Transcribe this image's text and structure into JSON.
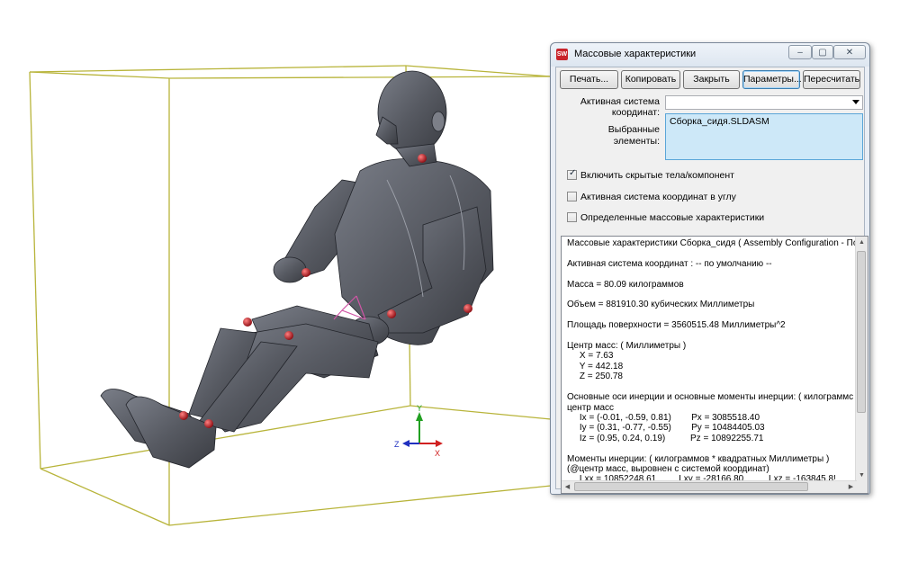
{
  "window": {
    "title": "Массовые характеристики",
    "app_icon": "SW",
    "controls": {
      "minimize": "–",
      "maximize": "▢",
      "close": "✕"
    }
  },
  "buttons": {
    "print": "Печать...",
    "copy": "Копировать",
    "close": "Закрыть",
    "options": "Параметры...",
    "recalculate": "Пересчитать"
  },
  "form": {
    "coord_label_line1": "Активная система",
    "coord_label_line2": "координат:",
    "coord_value": "",
    "selected_label": "Выбранные элементы:",
    "selected_value": "Сборка_сидя.SLDASM"
  },
  "checkboxes": [
    {
      "label": "Включить скрытые тела/компонент",
      "checked": true
    },
    {
      "label": "Активная система координат в углу",
      "checked": false
    },
    {
      "label": "Определенные массовые характеристики",
      "checked": false
    }
  ],
  "results": {
    "text": "Массовые характеристики Сборка_сидя ( Assembly Configuration - По\n\nАктивная система координат : -- по умолчанию --\n\nМасса = 80.09 килограммов\n\nОбъем = 881910.30 кубических Миллиметры\n\nПлощадь поверхности = 3560515.48 Миллиметры^2\n\nЦентр масс: ( Миллиметры )\n     X = 7.63\n     Y = 442.18\n     Z = 250.78\n\nОсновные оси инерции и основные моменты инерции: ( килограммс\nцентр масс\n     Ix = (-0.01, -0.59, 0.81)        Px = 3085518.40\n     Iy = (0.31, -0.77, -0.55)        Py = 10484405.03\n     Iz = (0.95, 0.24, 0.19)          Pz = 10892255.71\n\nМоменты инерции: ( килограммов * квадратных Миллиметры )\n(@центр масс, выровнен с системой координат)\n     Lxx = 10852248.61         Lxy = -28166.80          Lxz = -163845.8!"
  },
  "triad": {
    "x_label": "X",
    "y_label": "Y",
    "z_label": "Z"
  },
  "colors": {
    "model_body": "#5b5e66",
    "bounding_box": "#b8b43a",
    "joint_marker": "#c0141a",
    "dialog_bg": "#f0f0f0",
    "selection_bg": "#cde8f8"
  }
}
